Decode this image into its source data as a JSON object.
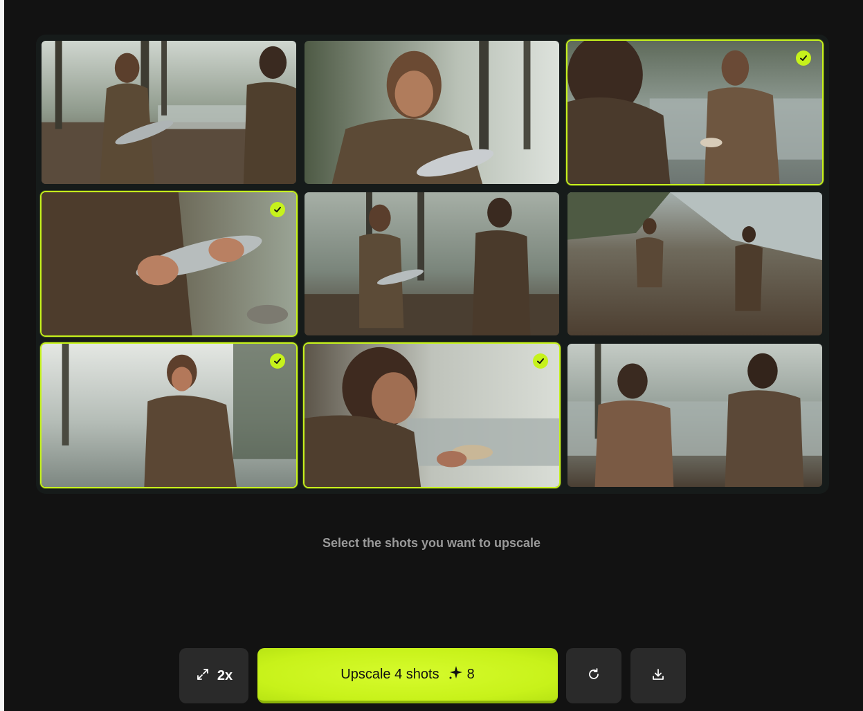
{
  "hint_text": "Select the shots you want to upscale",
  "toolbar": {
    "scale_label": "2x",
    "upscale_label": "Upscale 4 shots",
    "credit_cost": "8"
  },
  "colors": {
    "accent": "#c6f21c",
    "background": "#121212",
    "panel": "#161b1a",
    "button": "#2a2a2a"
  },
  "icons": {
    "scale": "expand-arrows-icon",
    "credits": "sparkle-icon",
    "refresh": "refresh-icon",
    "download": "download-icon",
    "selected": "checkmark-icon"
  },
  "shots": [
    {
      "id": 1,
      "selected": false
    },
    {
      "id": 2,
      "selected": false
    },
    {
      "id": 3,
      "selected": true
    },
    {
      "id": 4,
      "selected": true
    },
    {
      "id": 5,
      "selected": false
    },
    {
      "id": 6,
      "selected": false
    },
    {
      "id": 7,
      "selected": true
    },
    {
      "id": 8,
      "selected": true
    },
    {
      "id": 9,
      "selected": false
    }
  ]
}
